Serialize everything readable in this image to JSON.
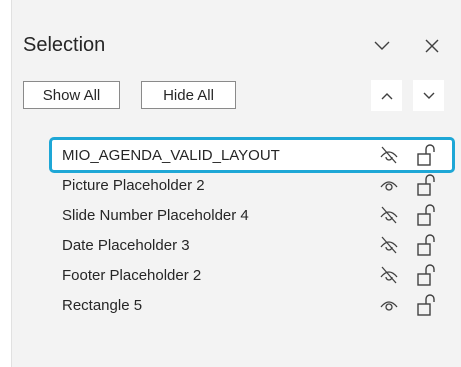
{
  "panel": {
    "title": "Selection",
    "header_icons": [
      "chevron-down-icon",
      "close-icon"
    ]
  },
  "toolbar": {
    "show_all_label": "Show All",
    "hide_all_label": "Hide All",
    "bring_forward_icon": "chevron-up-icon",
    "send_backward_icon": "chevron-down-icon"
  },
  "colors": {
    "selection_outline": "#1ea7d6",
    "pane_background": "#f3f3f3"
  },
  "items": [
    {
      "label": "MIO_AGENDA_VALID_LAYOUT",
      "visibility": "hidden-eye-icon",
      "lock": "unlocked-padlock-icon",
      "selected": true
    },
    {
      "label": "Picture Placeholder 2",
      "visibility": "eye-icon",
      "lock": "unlocked-padlock-icon",
      "selected": false
    },
    {
      "label": "Slide Number Placeholder 4",
      "visibility": "hidden-eye-icon",
      "lock": "unlocked-padlock-icon",
      "selected": false
    },
    {
      "label": "Date Placeholder 3",
      "visibility": "hidden-eye-icon",
      "lock": "unlocked-padlock-icon",
      "selected": false
    },
    {
      "label": "Footer Placeholder 2",
      "visibility": "hidden-eye-icon",
      "lock": "unlocked-padlock-icon",
      "selected": false
    },
    {
      "label": "Rectangle 5",
      "visibility": "eye-icon",
      "lock": "unlocked-padlock-icon",
      "selected": false
    }
  ]
}
